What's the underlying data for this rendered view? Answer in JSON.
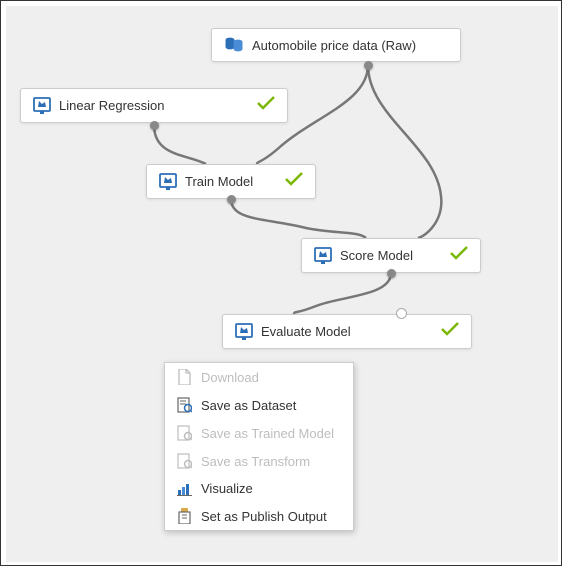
{
  "nodes": [
    {
      "label": "Automobile price data (Raw)",
      "status": "none"
    },
    {
      "label": "Linear Regression",
      "status": "ok"
    },
    {
      "label": "Train Model",
      "status": "ok"
    },
    {
      "label": "Score Model",
      "status": "ok"
    },
    {
      "label": "Evaluate Model",
      "status": "ok"
    }
  ],
  "connections": [
    {
      "from": "Automobile price data (Raw)",
      "to": "Train Model",
      "to_port": "right"
    },
    {
      "from": "Automobile price data (Raw)",
      "to": "Score Model",
      "to_port": "right"
    },
    {
      "from": "Linear Regression",
      "to": "Train Model",
      "to_port": "left"
    },
    {
      "from": "Train Model",
      "to": "Score Model",
      "to_port": "left"
    },
    {
      "from": "Score Model",
      "to": "Evaluate Model",
      "to_port": "left"
    }
  ],
  "context_menu": [
    {
      "label": "Download",
      "enabled": false
    },
    {
      "label": "Save as Dataset",
      "enabled": true
    },
    {
      "label": "Save as Trained Model",
      "enabled": false
    },
    {
      "label": "Save as Transform",
      "enabled": false
    },
    {
      "label": "Visualize",
      "enabled": true
    },
    {
      "label": "Set as Publish Output",
      "enabled": true
    }
  ],
  "colors": {
    "accent": "#2d6fb7",
    "success": "#7ab800",
    "disabled": "#bdbdbd",
    "canvas_bg": "#efefef"
  }
}
